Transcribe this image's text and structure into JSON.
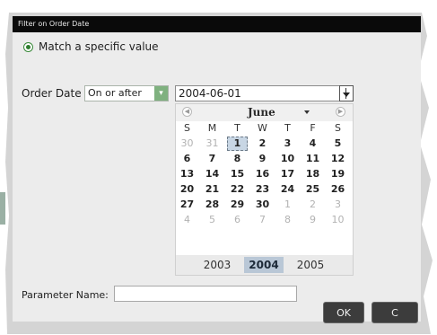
{
  "dialog": {
    "title": "Filter on Order Date"
  },
  "match_option": {
    "label": "Match a specific value",
    "selected": true
  },
  "order_date": {
    "label": "Order Date",
    "operator": "On or after",
    "value": "2004-06-01"
  },
  "calendar": {
    "month": "June",
    "weekdays": [
      "S",
      "M",
      "T",
      "W",
      "T",
      "F",
      "S"
    ],
    "weeks": [
      [
        "30",
        "31",
        "1",
        "2",
        "3",
        "4",
        "5"
      ],
      [
        "6",
        "7",
        "8",
        "9",
        "10",
        "11",
        "12"
      ],
      [
        "13",
        "14",
        "15",
        "16",
        "17",
        "18",
        "19"
      ],
      [
        "20",
        "21",
        "22",
        "23",
        "24",
        "25",
        "26"
      ],
      [
        "27",
        "28",
        "29",
        "30",
        "1",
        "2",
        "3"
      ],
      [
        "4",
        "5",
        "6",
        "7",
        "8",
        "9",
        "10"
      ]
    ],
    "years": [
      "2003",
      "2004",
      "2005"
    ],
    "selected_year": "2004",
    "selected_day": "1",
    "prev_icon": "chevron-left-icon",
    "next_icon": "chevron-right-icon"
  },
  "parameter": {
    "label": "Parameter Name:",
    "value": ""
  },
  "buttons": {
    "ok": "OK",
    "cancel": "C"
  },
  "colors": {
    "titlebar": "#0a0a0a",
    "selected_day": "#c8d6e4",
    "selected_year": "#b9c7d6",
    "dropdown_button": "#7fb17f"
  }
}
